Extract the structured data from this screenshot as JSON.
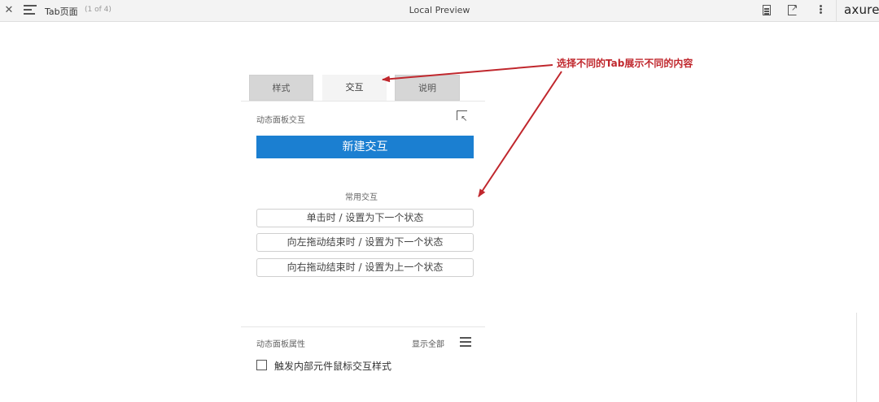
{
  "toolbar": {
    "close_icon": "close-icon",
    "menu_icon": "menu-icon",
    "page_name": "Tab页面",
    "page_count": "(1 of 4)",
    "title": "Local Preview",
    "notes_icon": "document-icon",
    "share_icon": "share-icon",
    "more_icon": "more-vertical-icon",
    "logo": "axure"
  },
  "panel": {
    "tabs": [
      {
        "label": "样式",
        "active": false
      },
      {
        "label": "交互",
        "active": true
      },
      {
        "label": "说明",
        "active": false
      }
    ],
    "interaction_section_label": "动态面板交互",
    "collapse_icon": "collapse-corner-icon",
    "new_interaction_button": "新建交互",
    "common_interactions_label": "常用交互",
    "common_interactions": [
      "单击时 / 设置为下一个状态",
      "向左拖动结束时 / 设置为下一个状态",
      "向右拖动结束时 / 设置为上一个状态"
    ],
    "properties_label": "动态面板属性",
    "show_all": "显示全部",
    "hamburger_icon": "hamburger-icon",
    "checkbox": {
      "label": "触发内部元件鼠标交互样式",
      "checked": false
    }
  },
  "annotation": {
    "text": "选择不同的Tab展示不同的内容",
    "color": "#c0272d"
  },
  "colors": {
    "accent": "#1b7fd1",
    "annotation": "#c0272d"
  }
}
